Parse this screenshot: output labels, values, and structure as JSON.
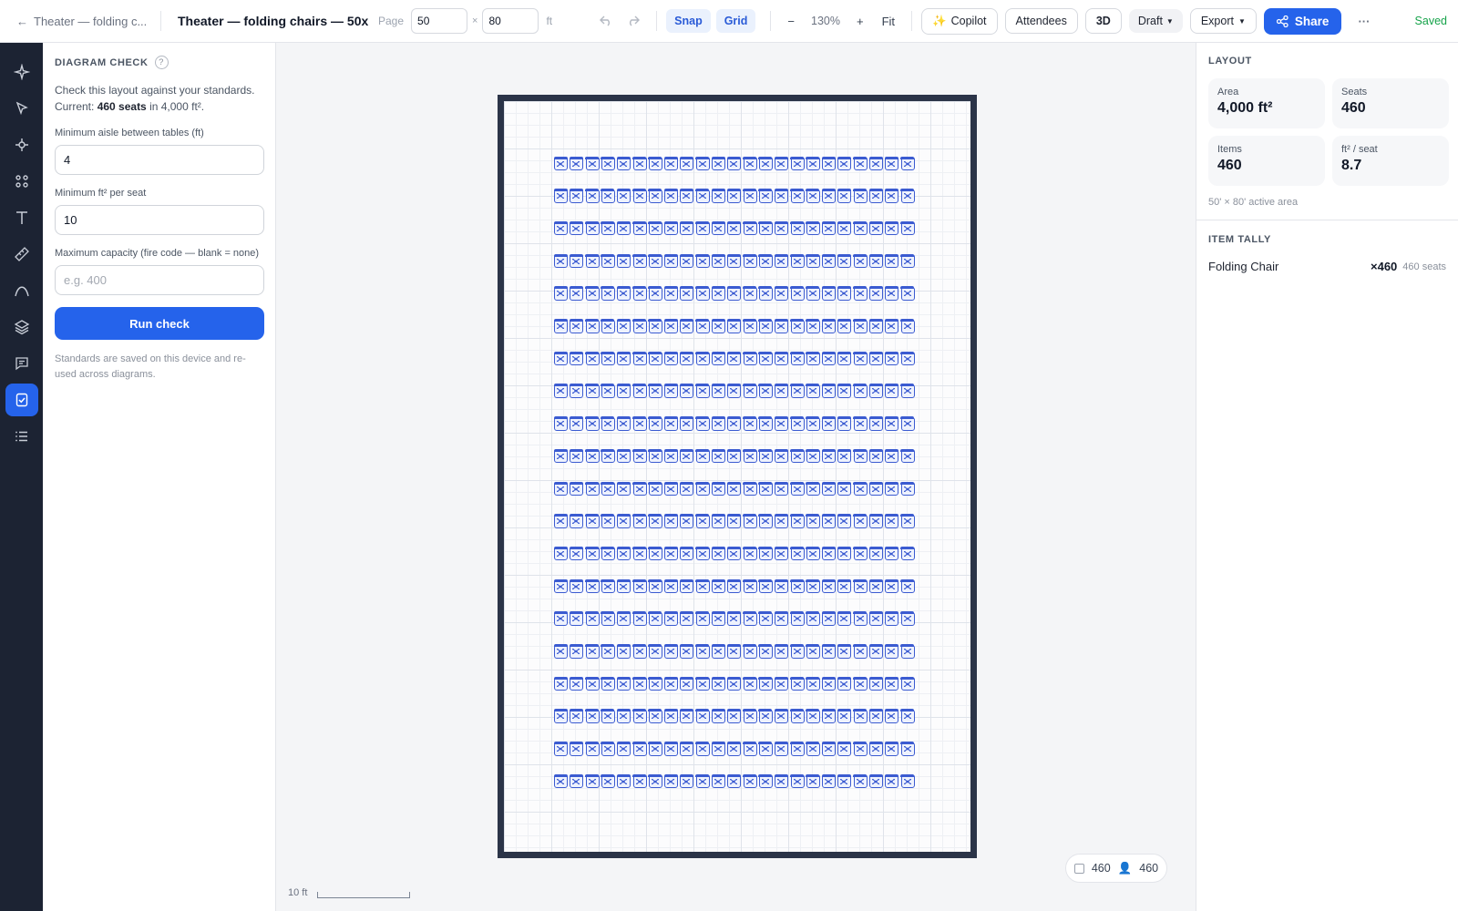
{
  "topbar": {
    "back_label": "Theater — folding c...",
    "title": "Theater — folding chairs — 50x",
    "page_label": "Page",
    "page_width": "50",
    "page_times": "×",
    "page_height": "80",
    "page_unit": "ft",
    "snap_label": "Snap",
    "grid_label": "Grid",
    "zoom_out_label": "−",
    "zoom_value": "130%",
    "zoom_in_label": "+",
    "fit_label": "Fit",
    "copilot_label": "Copilot",
    "attendees_label": "Attendees",
    "view3d_label": "3D",
    "draft_label": "Draft",
    "export_label": "Export",
    "share_label": "Share",
    "more_label": "···",
    "saved_label": "Saved"
  },
  "rail": {
    "items": [
      "sparkle-icon",
      "pointer-icon",
      "node-icon",
      "shapes-icon",
      "text-icon",
      "ruler-icon",
      "curve-icon",
      "layers-icon",
      "comment-icon",
      "checklist-icon",
      "list-icon"
    ],
    "active": "checklist-icon"
  },
  "diagram_check": {
    "title": "DIAGRAM CHECK",
    "help": "?",
    "desc_line1": "Check this layout against your standards.",
    "current_prefix": "Current: ",
    "current_seats": "460 seats",
    "current_suffix": " in 4,000 ft².",
    "aisle_label": "Minimum aisle between tables (ft)",
    "aisle_value": "4",
    "seat_label": "Minimum ft² per seat",
    "seat_value": "10",
    "capacity_label": "Maximum capacity (fire code — blank = none)",
    "capacity_value": "",
    "capacity_placeholder": "e.g. 400",
    "run_label": "Run check",
    "note": "Standards are saved on this device and re-used across diagrams."
  },
  "canvas": {
    "rows": 20,
    "cols": 23,
    "chair_color": "#3b5bd1",
    "scale_label": "10 ft",
    "chip_items": "460",
    "chip_people": "460"
  },
  "layout": {
    "title": "LAYOUT",
    "stats": [
      {
        "label": "Area",
        "value": "4,000 ft²"
      },
      {
        "label": "Seats",
        "value": "460"
      },
      {
        "label": "Items",
        "value": "460"
      },
      {
        "label": "ft² / seat",
        "value": "8.7"
      }
    ],
    "active_area": "50' × 80' active area"
  },
  "tally": {
    "title": "ITEM TALLY",
    "items": [
      {
        "name": "Folding Chair",
        "count": "×460",
        "seats": "460 seats"
      }
    ]
  },
  "colors": {
    "accent": "#2563eb",
    "rail_bg": "#1c2333",
    "saved": "#16a34a"
  }
}
